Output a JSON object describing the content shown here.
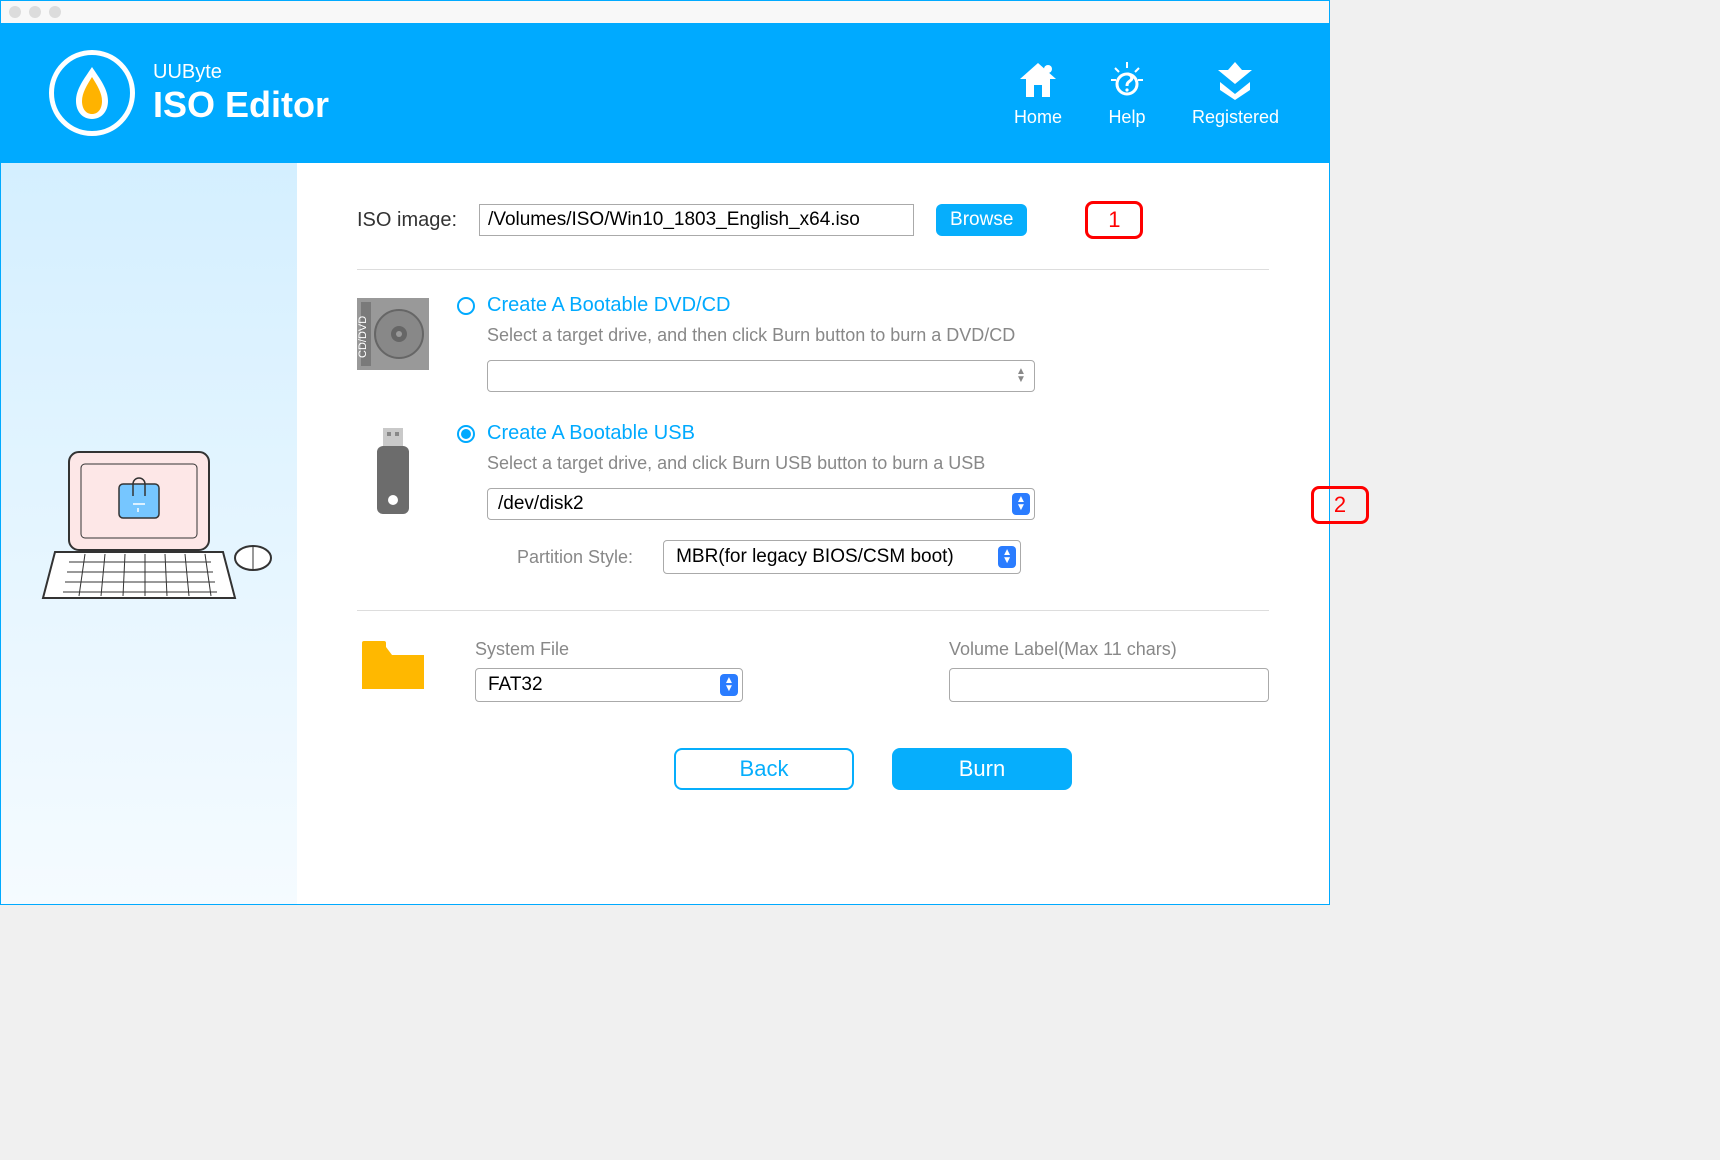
{
  "brand": {
    "sub": "UUByte",
    "title": "ISO Editor"
  },
  "header_actions": {
    "home": "Home",
    "help": "Help",
    "registered": "Registered"
  },
  "iso": {
    "label": "ISO image:",
    "path": "/Volumes/ISO/Win10_1803_English_x64.iso",
    "browse": "Browse"
  },
  "option_dvd": {
    "title": "Create A Bootable DVD/CD",
    "desc": "Select a target drive, and then click Burn button to burn a DVD/CD",
    "drive": ""
  },
  "option_usb": {
    "title": "Create A Bootable USB",
    "desc": "Select a target drive, and click Burn USB button to burn a USB",
    "drive": "/dev/disk2",
    "partition_label": "Partition Style:",
    "partition_value": "MBR(for legacy BIOS/CSM boot)"
  },
  "bottom": {
    "system_file_label": "System File",
    "system_file_value": "FAT32",
    "volume_label_label": "Volume Label(Max 11 chars)",
    "volume_label_value": ""
  },
  "buttons": {
    "back": "Back",
    "burn": "Burn"
  },
  "annotations": {
    "one": "1",
    "two": "2"
  }
}
